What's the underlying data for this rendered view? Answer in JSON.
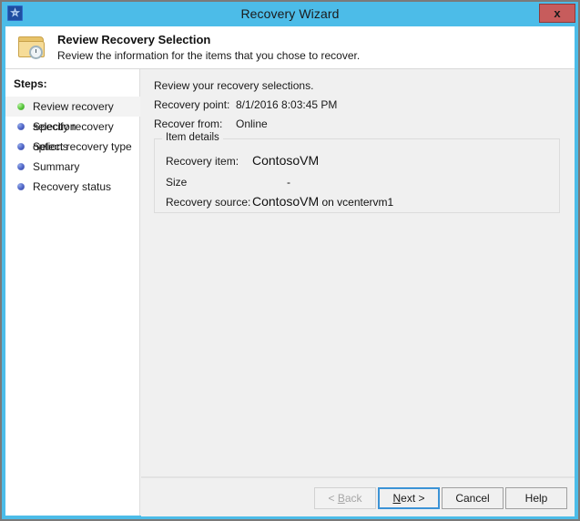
{
  "window": {
    "title": "Recovery Wizard",
    "app_icon": "recovery-clock-icon",
    "close_label": "x"
  },
  "header": {
    "icon": "folder-clock-icon",
    "title": "Review Recovery Selection",
    "subtitle": "Review the information for the items that you chose to recover."
  },
  "sidebar": {
    "label": "Steps:",
    "items": [
      {
        "label": "Review recovery selection",
        "state": "current",
        "bullet_color": "#4fc233"
      },
      {
        "label": "Specify recovery options",
        "state": "pending",
        "bullet_color": "#4a5fc4"
      },
      {
        "label": "Select recovery type",
        "state": "pending",
        "bullet_color": "#4a5fc4"
      },
      {
        "label": "Summary",
        "state": "pending",
        "bullet_color": "#4a5fc4"
      },
      {
        "label": "Recovery status",
        "state": "pending",
        "bullet_color": "#4a5fc4"
      }
    ]
  },
  "content": {
    "intro": "Review your recovery selections.",
    "recovery_point_label": "Recovery point:",
    "recovery_point_value": "8/1/2016 8:03:45 PM",
    "recover_from_label": "Recover from:",
    "recover_from_value": "Online",
    "item_details": {
      "legend": "Item details",
      "recovery_item_label": "Recovery item:",
      "recovery_item_value": "ContosoVM",
      "size_label": "Size",
      "size_value": "-",
      "recovery_source_label": "Recovery source:",
      "recovery_source_value": "ContosoVM",
      "recovery_source_suffix": " on vcentervm1"
    }
  },
  "footer": {
    "back": {
      "prefix": "< ",
      "mnemonic": "B",
      "rest": "ack",
      "disabled": true
    },
    "next": {
      "mnemonic": "N",
      "rest": "ext >",
      "focused": true
    },
    "cancel": "Cancel",
    "help": "Help"
  },
  "colors": {
    "titlebar": "#4cbce8",
    "close_button": "#c75c5c",
    "content_bg": "#f0f0f0",
    "sidebar_bg": "#ffffff",
    "focus_border": "#3c93d6"
  }
}
